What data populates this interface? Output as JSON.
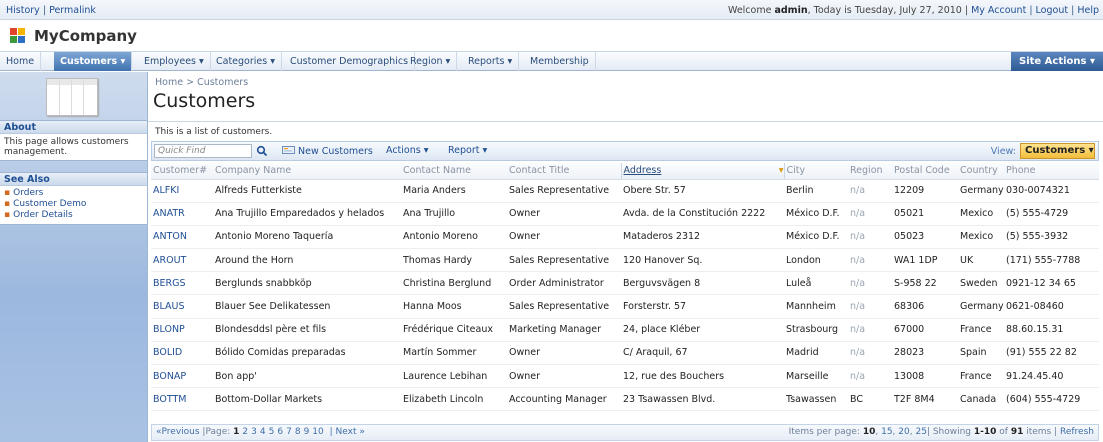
{
  "topbar": {
    "history": "History",
    "sep1": " | ",
    "permalink": "Permalink",
    "welcome_prefix": "Welcome ",
    "user": "admin",
    "welcome_suffix": ", Today is Tuesday, July 27, 2010 | ",
    "my_account": "My Account",
    "sep2": " | ",
    "logout": "Logout",
    "sep3": " | ",
    "help": "Help"
  },
  "brand": {
    "title": "MyCompany"
  },
  "menu": {
    "items": [
      {
        "label": "Home"
      },
      {
        "label": "Customers ▾"
      },
      {
        "label": "Employees ▾"
      },
      {
        "label": "Categories ▾"
      },
      {
        "label": "Customer Demographics"
      },
      {
        "label": "Region ▾"
      },
      {
        "label": "Reports ▾"
      },
      {
        "label": "Membership"
      }
    ],
    "site_actions": "Site Actions ▾"
  },
  "sidebar": {
    "about_title": "About",
    "about_text": "This page allows customers management.",
    "see_also_title": "See Also",
    "links": [
      "Orders",
      "Customer Demo",
      "Order Details"
    ]
  },
  "page": {
    "breadcrumb": "Home > Customers",
    "title": "Customers",
    "description": "This is a list of customers."
  },
  "toolbar": {
    "quick_find_placeholder": "Quick Find",
    "new_customers": "New Customers",
    "actions": "Actions ▾",
    "report": "Report ▾",
    "view_label": "View:",
    "view_value": "Customers ▾"
  },
  "grid": {
    "columns": [
      "Customer#",
      "Company Name",
      "Contact Name",
      "Contact Title",
      "Address",
      "City",
      "Region",
      "Postal Code",
      "Country",
      "Phone"
    ],
    "rows": [
      [
        "ALFKI",
        "Alfreds Futterkiste",
        "Maria Anders",
        "Sales Representative",
        "Obere Str. 57",
        "Berlin",
        "n/a",
        "12209",
        "Germany",
        "030-0074321"
      ],
      [
        "ANATR",
        "Ana Trujillo Emparedados y helados",
        "Ana Trujillo",
        "Owner",
        "Avda. de la Constitución 2222",
        "México D.F.",
        "n/a",
        "05021",
        "Mexico",
        "(5) 555-4729"
      ],
      [
        "ANTON",
        "Antonio Moreno Taquería",
        "Antonio Moreno",
        "Owner",
        "Mataderos 2312",
        "México D.F.",
        "n/a",
        "05023",
        "Mexico",
        "(5) 555-3932"
      ],
      [
        "AROUT",
        "Around the Horn",
        "Thomas Hardy",
        "Sales Representative",
        "120 Hanover Sq.",
        "London",
        "n/a",
        "WA1 1DP",
        "UK",
        "(171) 555-7788"
      ],
      [
        "BERGS",
        "Berglunds snabbköp",
        "Christina Berglund",
        "Order Administrator",
        "Berguvsvägen 8",
        "Luleå",
        "n/a",
        "S-958 22",
        "Sweden",
        "0921-12 34 65"
      ],
      [
        "BLAUS",
        "Blauer See Delikatessen",
        "Hanna Moos",
        "Sales Representative",
        "Forsterstr. 57",
        "Mannheim",
        "n/a",
        "68306",
        "Germany",
        "0621-08460"
      ],
      [
        "BLONP",
        "Blondesddsl père et fils",
        "Frédérique Citeaux",
        "Marketing Manager",
        "24, place Kléber",
        "Strasbourg",
        "n/a",
        "67000",
        "France",
        "88.60.15.31"
      ],
      [
        "BOLID",
        "Bólido Comidas preparadas",
        "Martín Sommer",
        "Owner",
        "C/ Araquil, 67",
        "Madrid",
        "n/a",
        "28023",
        "Spain",
        "(91) 555 22 82"
      ],
      [
        "BONAP",
        "Bon app'",
        "Laurence Lebihan",
        "Owner",
        "12, rue des Bouchers",
        "Marseille",
        "n/a",
        "13008",
        "France",
        "91.24.45.40"
      ],
      [
        "BOTTM",
        "Bottom-Dollar Markets",
        "Elizabeth Lincoln",
        "Accounting Manager",
        "23 Tsawassen Blvd.",
        "Tsawassen",
        "BC",
        "T2F 8M4",
        "Canada",
        "(604) 555-4729"
      ]
    ]
  },
  "pager": {
    "previous": "«Previous",
    "page_label": "|Page:",
    "pages": [
      "1",
      "2",
      "3",
      "4",
      "5",
      "6",
      "7",
      "8",
      "9",
      "10"
    ],
    "next": "| Next »",
    "items_per_page_label": "Items per page:",
    "sizes": [
      "10",
      "15",
      "20",
      "25"
    ],
    "showing_prefix": "| Showing ",
    "showing_range": "1-10",
    "showing_of": " of ",
    "total": "91",
    "showing_suffix": " items | ",
    "refresh": "Refresh"
  }
}
